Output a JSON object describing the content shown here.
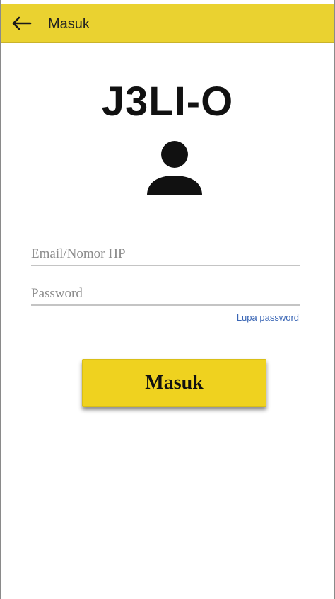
{
  "appbar": {
    "back_icon": "arrow-left-icon",
    "title": "Masuk"
  },
  "header": {
    "app_name": "J3LI-O",
    "avatar_icon": "user-icon"
  },
  "form": {
    "email_placeholder": "Email/Nomor HP",
    "email_value": "",
    "password_placeholder": "Password",
    "password_value": "",
    "forgot_label": "Lupa password",
    "submit_label": "Masuk"
  },
  "colors": {
    "accent": "#ead230",
    "button": "#efd21f",
    "link": "#3a66b5"
  }
}
